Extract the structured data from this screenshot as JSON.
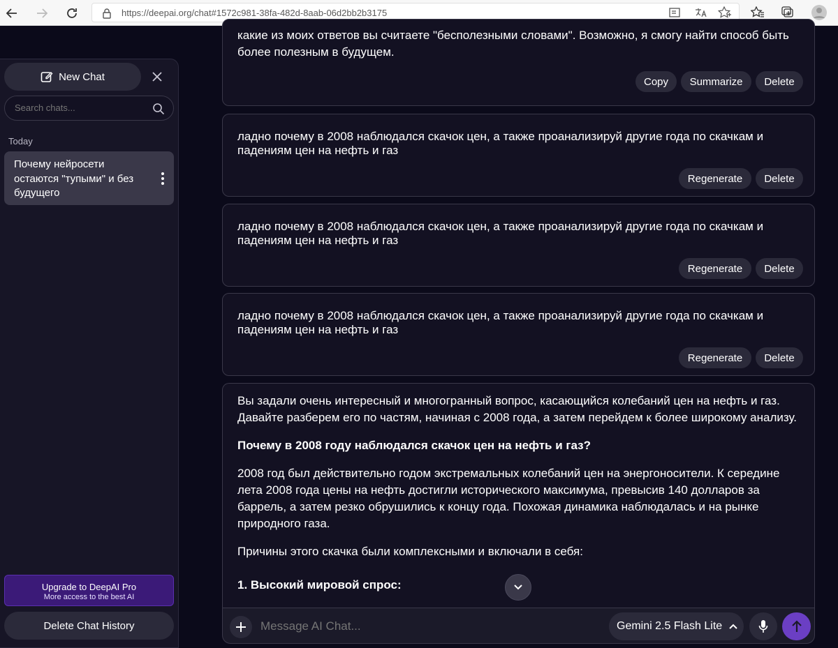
{
  "browser": {
    "url": "https://deepai.org/chat#1572c981-38fa-482d-8aab-06d2bb2b3175"
  },
  "sidebar": {
    "new_chat_label": "New Chat",
    "search_placeholder": "Search chats...",
    "section_today": "Today",
    "chats": [
      {
        "title": "Почему нейросети остаются \"тупыми\" и без будущего"
      }
    ],
    "upgrade_title": "Upgrade to DeepAI Pro",
    "upgrade_subtitle": "More access to the best AI",
    "delete_history_label": "Delete Chat History"
  },
  "messages": {
    "prev_answer_tail": "какие из моих ответов вы считаете \"бесполезными словами\". Возможно, я смогу найти способ быть более полезным в будущем.",
    "prev_answer_actions": {
      "copy": "Copy",
      "summarize": "Summarize",
      "delete": "Delete"
    },
    "user_messages": [
      "ладно почему в 2008 наблюдался скачок цен, а также проанализируй другие года по скачкам и падениям цен на нефть и газ",
      "ладно почему в 2008 наблюдался скачок цен, а также проанализируй другие года по скачкам и падениям цен на нефть и газ",
      "ладно почему в 2008 наблюдался скачок цен, а также проанализируй другие года по скачкам и падениям цен на нефть и газ"
    ],
    "user_actions": {
      "regenerate": "Regenerate",
      "delete": "Delete"
    },
    "answer": {
      "intro": "Вы задали очень интересный и многогранный вопрос, касающийся колебаний цен на нефть и газ. Давайте разберем его по частям, начиная с 2008 года, а затем перейдем к более широкому анализу.",
      "heading": "Почему в 2008 году наблюдался скачок цен на нефть и газ?",
      "paragraph": "2008 год был действительно годом экстремальных колебаний цен на энергоносители. К середине лета 2008 года цены на нефть достигли исторического максимума, превысив 140 долларов за баррель, а затем резко обрушились к концу года. Похожая динамика наблюдалась и на рынке природного газа.",
      "causes_intro": "Причины этого скачка были комплексными и включали в себя:",
      "list_item_1": "1. Высокий мировой спрос:"
    }
  },
  "composer": {
    "placeholder": "Message AI Chat...",
    "model_label": "Gemini 2.5 Flash Lite"
  }
}
